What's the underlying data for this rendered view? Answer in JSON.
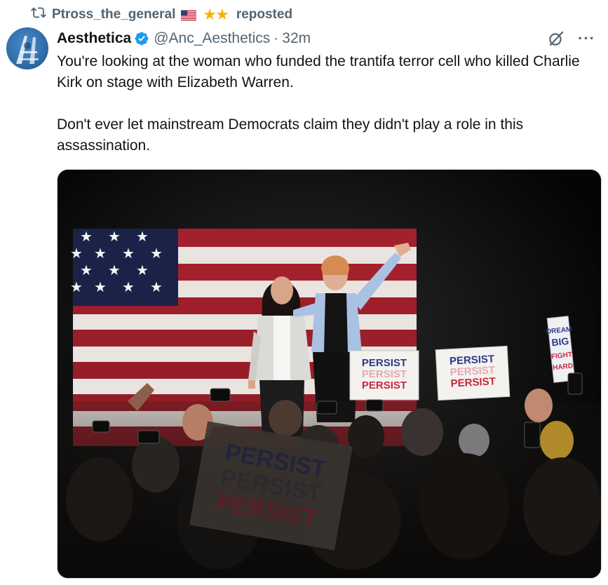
{
  "repost": {
    "icon": "repost-icon",
    "username": "Ptross_the_general",
    "emoji": "🇺🇸⭐⭐",
    "label": "reposted"
  },
  "author": {
    "avatar": "avatar",
    "display_name": "Aesthetica",
    "verified_icon": "verified-badge-icon",
    "handle": "@Anc_Aesthetics",
    "separator": "·",
    "time": "32m"
  },
  "actions": {
    "grok_icon": "grok-icon",
    "more_icon": "more-icon",
    "more_label": "···"
  },
  "tweet": {
    "paragraph_1": "You're looking at the woman who funded the trantifa terror cell who killed Charlie Kirk on stage with Elizabeth Warren.",
    "paragraph_2": "Don't ever let mainstream Democrats claim they didn't play a role in this assassination."
  },
  "media": {
    "signs": [
      {
        "line1": "PERSIST",
        "line2": "PERSIST",
        "line3": "PERSIST"
      },
      {
        "line1": "PERSIST",
        "line2": "PERSIST",
        "line3": "PERSIST"
      },
      {
        "line1": "PERSIST",
        "line2": "PERSIST",
        "line3": "PERSIST"
      }
    ],
    "side_sign": {
      "line1": "DREAM",
      "line2": "BIG",
      "line3": "FIGHT",
      "line4": "HARD"
    }
  },
  "colors": {
    "secondary_text": "#536471",
    "verified_blue": "#1d9bf0",
    "star_gold": "#f5b301",
    "sign_blue": "#2d3b8c",
    "sign_red": "#c9283e"
  }
}
